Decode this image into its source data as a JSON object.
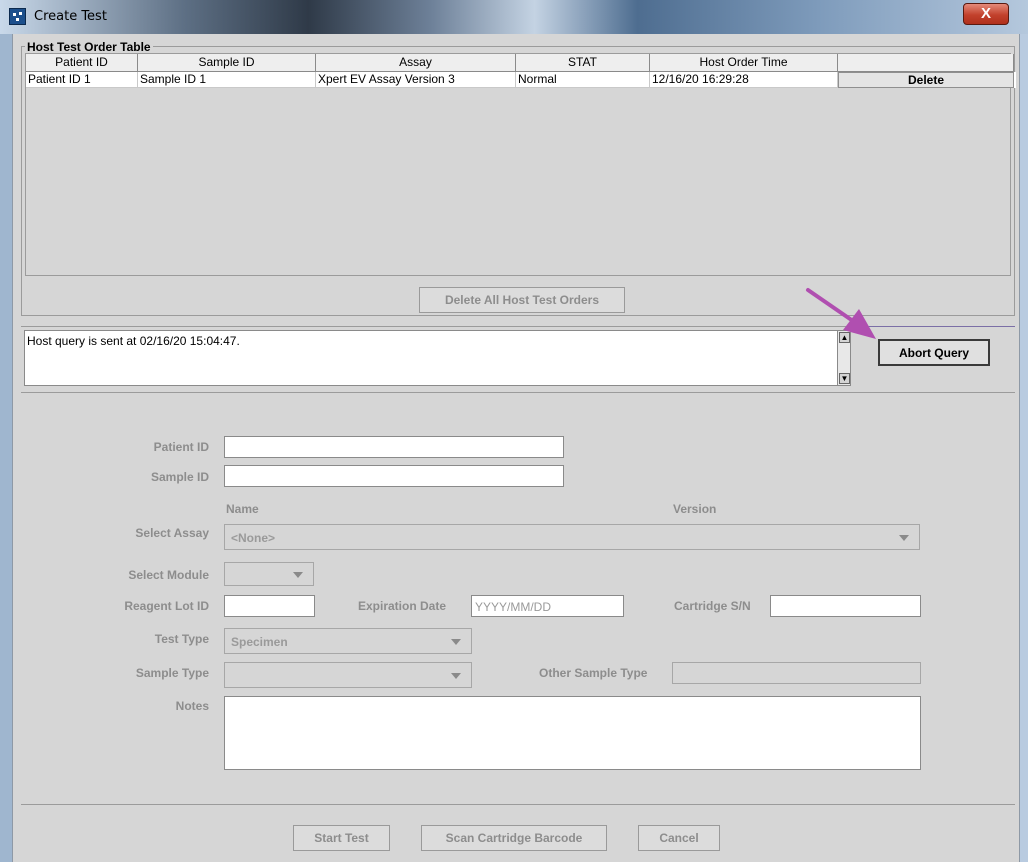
{
  "window": {
    "title": "Create Test",
    "close_label": "X"
  },
  "host_table": {
    "group_label": "Host Test Order Table",
    "columns": [
      "Patient ID",
      "Sample ID",
      "Assay",
      "STAT",
      "Host Order Time",
      ""
    ],
    "rows": [
      {
        "patient_id": "Patient ID 1",
        "sample_id": "Sample ID 1",
        "assay": "Xpert EV Assay Version 3",
        "stat": "Normal",
        "host_order_time": "12/16/20  16:29:28",
        "action": "Delete"
      }
    ],
    "delete_all_label": "Delete All Host Test Orders"
  },
  "query": {
    "message": "Host query is sent at 02/16/20 15:04:47.",
    "abort_label": "Abort Query"
  },
  "form": {
    "patient_id_label": "Patient ID",
    "patient_id_value": "",
    "sample_id_label": "Sample ID",
    "sample_id_value": "",
    "name_header": "Name",
    "version_header": "Version",
    "select_assay_label": "Select Assay",
    "select_assay_value": "<None>",
    "select_module_label": "Select Module",
    "select_module_value": "",
    "reagent_lot_label": "Reagent Lot ID",
    "expiration_label": "Expiration Date",
    "expiration_placeholder": "YYYY/MM/DD",
    "cartridge_label": "Cartridge S/N",
    "test_type_label": "Test Type",
    "test_type_value": "Specimen",
    "sample_type_label": "Sample Type",
    "sample_type_value": "",
    "other_sample_type_label": "Other Sample Type",
    "notes_label": "Notes"
  },
  "footer": {
    "start_test_label": "Start Test",
    "scan_label": "Scan Cartridge Barcode",
    "cancel_label": "Cancel"
  },
  "colors": {
    "annotation_arrow": "#b04fb0",
    "close_button": "#c2412c"
  }
}
